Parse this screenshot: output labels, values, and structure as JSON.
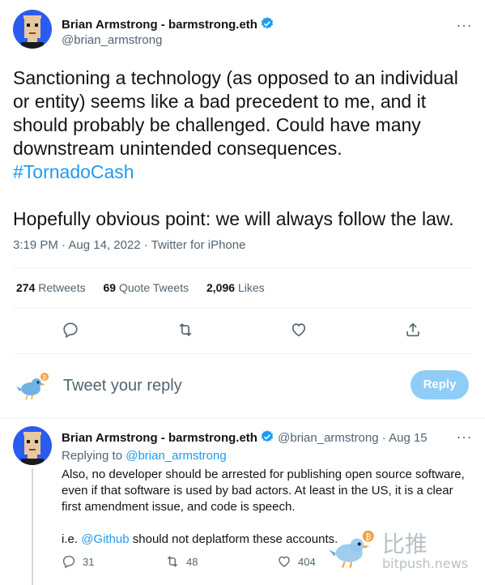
{
  "tweet": {
    "author_name": "Brian Armstrong - barmstrong.eth",
    "handle": "@brian_armstrong",
    "more": "···",
    "text_1": "Sanctioning a technology (as opposed to an individual or entity) seems like a bad precedent to me, and it should probably be challenged. Could have many downstream unintended consequences.",
    "hashtag": "#TornadoCash",
    "text_2": "Hopefully obvious point: we will always follow the law.",
    "time": "3:19 PM",
    "date": "Aug 14, 2022",
    "client": "Twitter for iPhone",
    "sep": "·"
  },
  "stats": {
    "retweets_count": "274",
    "retweets_label": "Retweets",
    "quotes_count": "69",
    "quotes_label": "Quote Tweets",
    "likes_count": "2,096",
    "likes_label": "Likes"
  },
  "reply_box": {
    "placeholder": "Tweet your reply",
    "button": "Reply"
  },
  "reply": {
    "author_name": "Brian Armstrong - barmstrong.eth",
    "handle": "@brian_armstrong",
    "date": "Aug 15",
    "sep": "·",
    "more": "···",
    "replying_prefix": "Replying to",
    "replying_to": "@brian_armstrong",
    "text_1": "Also, no developer should be arrested for publishing open source software, even if that software is used by bad actors. At least in the US, it is a clear first amendment issue, and code is speech.",
    "text_2_prefix": "i.e.",
    "text_2_mention": "@Github",
    "text_2_suffix": "should not deplatform these accounts.",
    "replies": "31",
    "retweets": "48",
    "likes": "404"
  },
  "watermark": {
    "cn": "比推",
    "url": "bitpush.news"
  },
  "colors": {
    "accent": "#1d9bf0",
    "avatar_bg": "#2b5cf0",
    "reply_button": "#8ecdf8",
    "secondary_text": "#536471"
  }
}
